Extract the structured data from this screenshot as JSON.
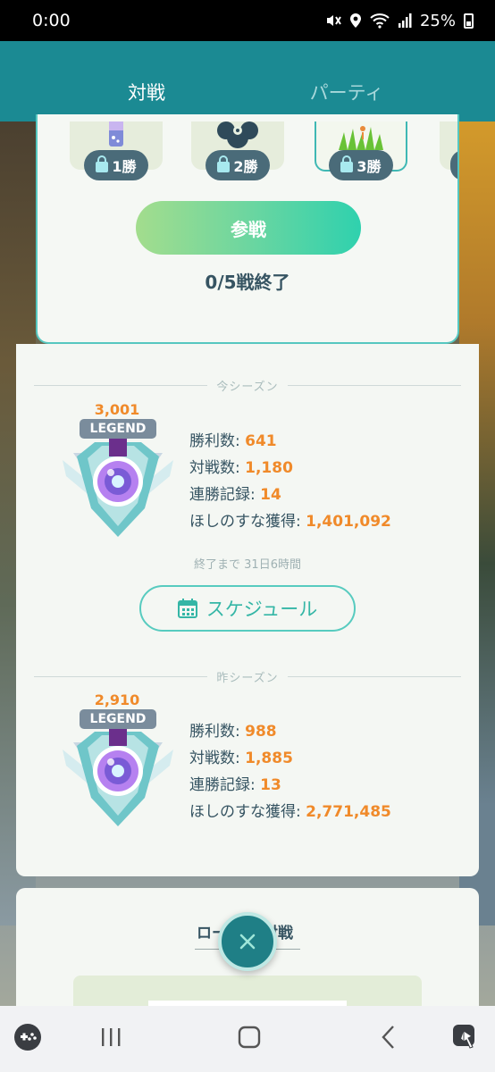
{
  "status_bar": {
    "time": "0:00",
    "battery_percent": "25%",
    "icons": [
      "mute-icon",
      "location-icon",
      "wifi-icon",
      "signal-icon",
      "battery-icon"
    ]
  },
  "tabs": [
    {
      "label": "対戦",
      "active": true
    },
    {
      "label": "パーティ",
      "active": false
    }
  ],
  "league": {
    "rewards": [
      {
        "label": "1勝",
        "icon": "lock-icon"
      },
      {
        "label": "2勝",
        "icon": "lock-icon"
      },
      {
        "label": "3勝",
        "icon": "lock-icon"
      }
    ],
    "join_label": "参戦",
    "progress_text": "0/5戦終了"
  },
  "current_season": {
    "divider_label": "今シーズン",
    "rating": "3,001",
    "rank": "LEGEND",
    "stats": [
      {
        "label": "勝利数: ",
        "value": "641"
      },
      {
        "label": "対戦数: ",
        "value": "1,180"
      },
      {
        "label": "連勝記録: ",
        "value": "14"
      },
      {
        "label": "ほしのすな獲得: ",
        "value": "1,401,092"
      }
    ],
    "ends_in": "終了まで 31日6時間",
    "schedule_label": "スケジュール"
  },
  "previous_season": {
    "divider_label": "昨シーズン",
    "rating": "2,910",
    "rank": "LEGEND",
    "stats": [
      {
        "label": "勝利数: ",
        "value": "988"
      },
      {
        "label": "対戦数: ",
        "value": "1,885"
      },
      {
        "label": "連勝記録: ",
        "value": "13"
      },
      {
        "label": "ほしのすな獲得: ",
        "value": "2,771,485"
      }
    ]
  },
  "bottom_card": {
    "title_left": "ロー",
    "title_right": "対戦"
  },
  "colors": {
    "header": "#1b8a93",
    "accent_orange": "#f08a2a",
    "text_dark": "#365462",
    "teal_border": "#56c7c0"
  }
}
